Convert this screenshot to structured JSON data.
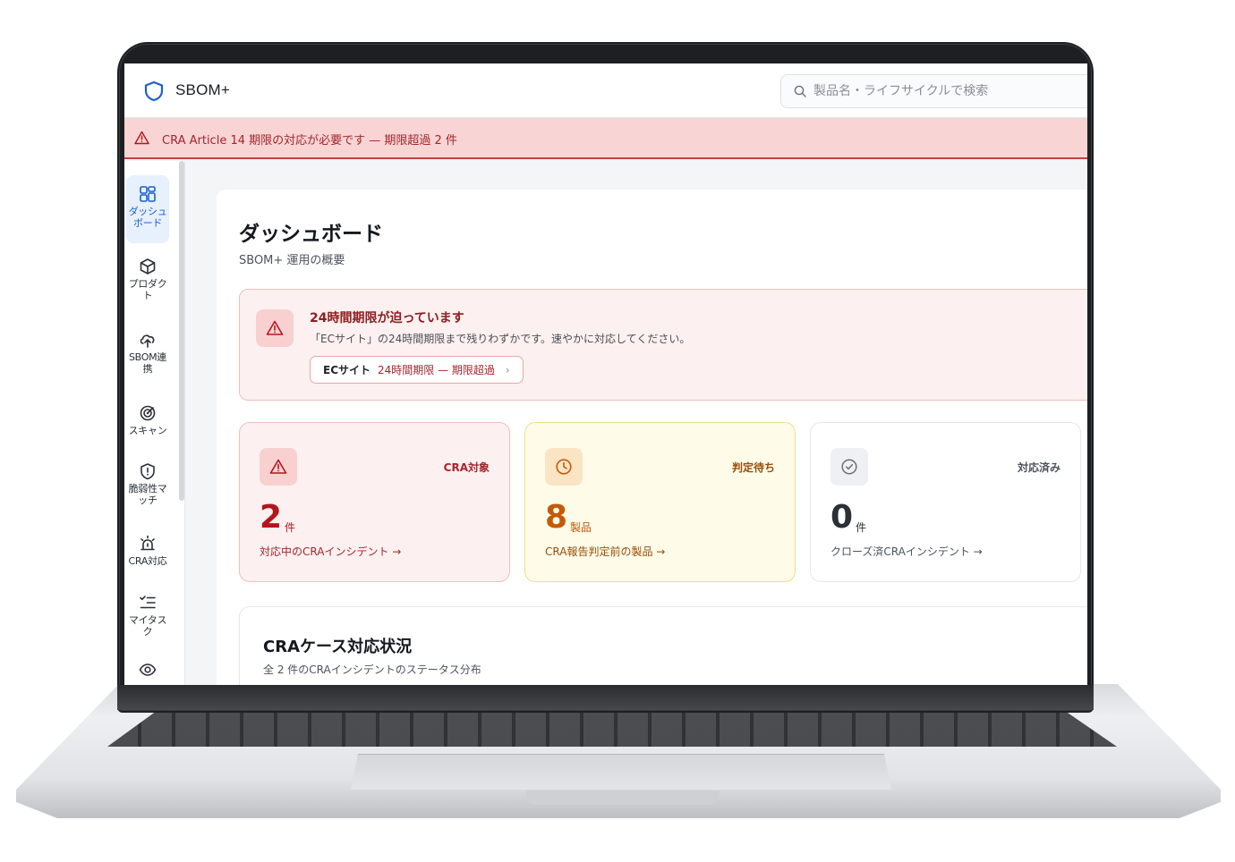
{
  "app": {
    "title": "SBOM+"
  },
  "search": {
    "placeholder": "製品名・ライフサイクルで検索"
  },
  "alert_banner": {
    "text": "CRA Article 14 期限の対応が必要です — 期限超過 2 件"
  },
  "sidebar": {
    "items": [
      {
        "label": "ダッシュボード",
        "icon": "dashboard-icon",
        "active": true
      },
      {
        "label": "プロダクト",
        "icon": "cube-icon"
      },
      {
        "label": "SBOM連携",
        "icon": "cloud-upload-icon"
      },
      {
        "label": "スキャン",
        "icon": "radar-icon"
      },
      {
        "label": "脆弱性マッチ",
        "icon": "shield-alert-icon"
      },
      {
        "label": "CRA対応",
        "icon": "siren-icon"
      },
      {
        "label": "マイタスク",
        "icon": "checklist-icon"
      },
      {
        "label": "",
        "icon": "eye-icon"
      }
    ]
  },
  "page": {
    "title": "ダッシュボード",
    "subtitle": "SBOM+ 運用の概要"
  },
  "deadline_warning": {
    "title": "24時間期限が迫っています",
    "description": "「ECサイト」の24時間期限まで残りわずかです。速やかに対応してください。",
    "chip": {
      "product": "ECサイト",
      "status": "24時間期限 — 期限超過"
    }
  },
  "stats": [
    {
      "label": "CRA対象",
      "value": "2",
      "unit": "件",
      "link": "対応中のCRAインシデント →",
      "color": "#b3151c"
    },
    {
      "label": "判定待ち",
      "value": "8",
      "unit": "製品",
      "link": "CRA報告判定前の製品 →",
      "color": "#c45a07"
    },
    {
      "label": "対応済み",
      "value": "0",
      "unit": "件",
      "link": "クローズ済CRAインシデント →",
      "color": "#2b2f36"
    }
  ],
  "cases": {
    "title": "CRAケース対応状況",
    "subtitle": "全 2 件のCRAインシデントのステータス分布"
  },
  "colors": {
    "accent": "#1d5fd0",
    "danger": "#c24141",
    "warning": "#c45a07"
  }
}
